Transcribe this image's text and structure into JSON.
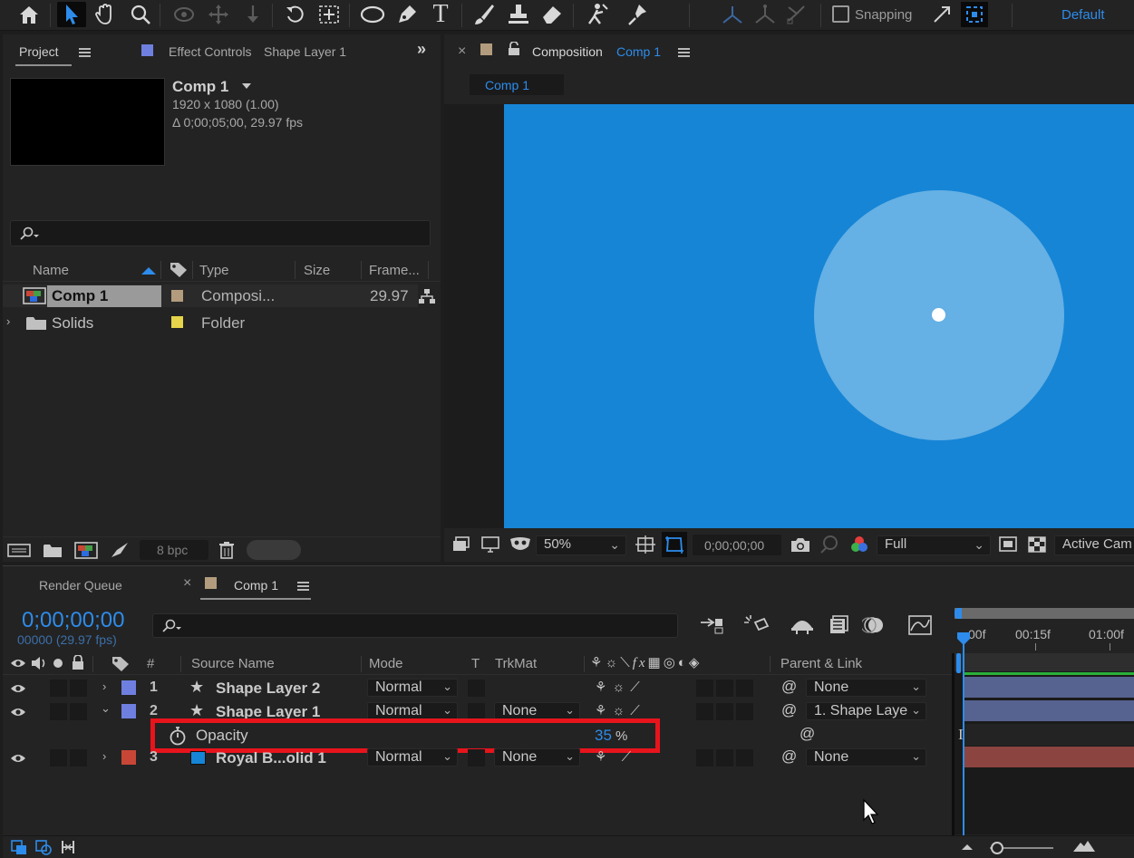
{
  "toolbar": {
    "snapping_label": "Snapping",
    "workspace_label": "Default",
    "tools": [
      "home-icon",
      "selection-icon",
      "hand-icon",
      "zoom-icon",
      "orbit-icon",
      "pan-icon",
      "dolly-icon",
      "rotate-icon",
      "pan-behind-icon",
      "ellipse-icon",
      "pen-icon",
      "text-icon",
      "brush-icon",
      "clone-stamp-icon",
      "eraser-icon",
      "roto-brush-icon",
      "puppet-icon"
    ]
  },
  "project_panel": {
    "tab_project": "Project",
    "tab_effect_controls": "Effect Controls",
    "tab_effect_target": "Shape Layer 1",
    "comp_name": "Comp 1",
    "comp_resolution": "1920 x 1080 (1.00)",
    "comp_duration": "Δ 0;00;05;00, 29.97 fps",
    "search_placeholder": "",
    "columns": [
      "Name",
      "Type",
      "Size",
      "Frame..."
    ],
    "items": [
      {
        "name": "Comp 1",
        "type": "Composi...",
        "frame": "29.97",
        "swatch": "#b39c7e"
      },
      {
        "name": "Solids",
        "type": "Folder",
        "frame": "",
        "swatch": "#e6d44a"
      }
    ],
    "bpc": "8 bpc"
  },
  "composition_panel": {
    "tab_label": "Composition",
    "tab_comp": "Comp 1",
    "breadcrumb": "Comp 1",
    "canvas_color": "#1685d6",
    "circle_color": "#65b0e4",
    "zoom": "50%",
    "timecode": "0;00;00;00",
    "resolution": "Full",
    "camera": "Active Cam"
  },
  "timeline_panel": {
    "tab_render_queue": "Render Queue",
    "tab_comp": "Comp 1",
    "timecode": "0;00;00;00",
    "frame_info": "00000 (29.97 fps)",
    "ruler": [
      "00f",
      "00:15f",
      "01:00f"
    ],
    "headers": {
      "num": "#",
      "source": "Source Name",
      "mode": "Mode",
      "t": "T",
      "trkmat": "TrkMat",
      "parent": "Parent & Link"
    },
    "layers": [
      {
        "num": "1",
        "name": "Shape Layer 2",
        "mode": "Normal",
        "trkmat": "",
        "parent": "None",
        "color": "#6f7fe0",
        "bar": "#56628f"
      },
      {
        "num": "2",
        "name": "Shape Layer 1",
        "mode": "Normal",
        "trkmat": "None",
        "parent": "1. Shape Laye",
        "color": "#6f7fe0",
        "bar": "#56628f"
      },
      {
        "num": "3",
        "name": "Royal B...olid 1",
        "mode": "Normal",
        "trkmat": "None",
        "parent": "None",
        "color": "#c84636",
        "bar": "#8c4440"
      }
    ],
    "property": {
      "name": "Opacity",
      "value": "35",
      "unit": "%"
    }
  }
}
